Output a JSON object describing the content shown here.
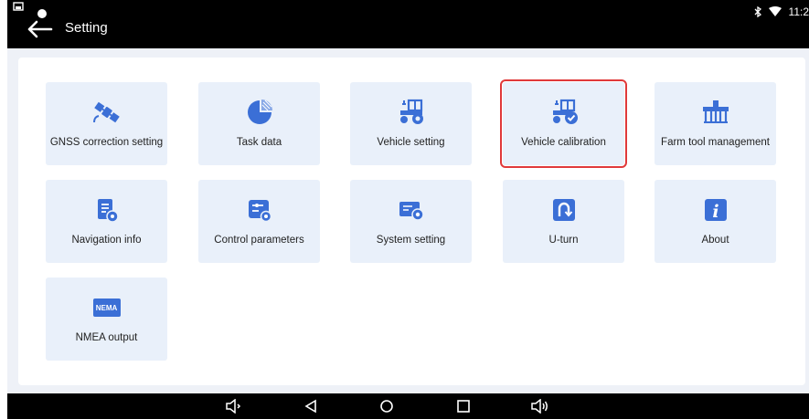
{
  "header": {
    "title": "Setting",
    "time": "11:2"
  },
  "menu": {
    "items": [
      {
        "label": "GNSS correction setting"
      },
      {
        "label": "Task data"
      },
      {
        "label": "Vehicle setting"
      },
      {
        "label": "Vehicle calibration"
      },
      {
        "label": "Farm tool management"
      },
      {
        "label": "Navigation info"
      },
      {
        "label": "Control parameters"
      },
      {
        "label": "System setting"
      },
      {
        "label": "U-turn"
      },
      {
        "label": "About"
      },
      {
        "label": "NMEA output"
      }
    ],
    "selected_label": "Vehicle calibration",
    "nmea_badge": "NEMA"
  },
  "colors": {
    "icon_blue": "#3b6fd6",
    "tile_bg": "#e9f0fa",
    "highlight": "#e0393a"
  },
  "icons": [
    "satellite-icon",
    "pie-chart-icon",
    "tractor-icon",
    "tractor-check-icon",
    "farm-tool-icon",
    "navigation-info-icon",
    "control-parameters-icon",
    "system-setting-icon",
    "u-turn-icon",
    "info-icon",
    "nmea-icon"
  ]
}
